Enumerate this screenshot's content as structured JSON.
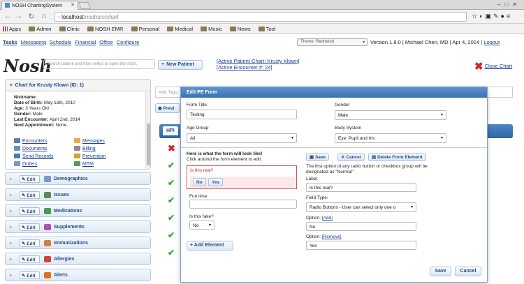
{
  "browser": {
    "tab_title": "NOSH ChartingSystem",
    "url_host": "localhost",
    "url_path": "/noshsrc/chart",
    "bookmarks": [
      "Apps",
      "Admin",
      "Clinic",
      "NOSH EMR",
      "Personal",
      "Medical",
      "Music",
      "News",
      "Tool"
    ]
  },
  "app": {
    "menu": [
      "Tasks",
      "Messaging",
      "Schedule",
      "Financial",
      "Office",
      "Configure"
    ],
    "theme_label": "Theme: Redmond",
    "version": "Version 1.8.0",
    "user": "Michael Chen, MD",
    "date": "Apr 4, 2014",
    "logout": "Logout",
    "logo": "Nosh",
    "search_placeholder": "Search patient and then select to open the chart.",
    "new_patient": "New Patient",
    "active_patient": "[Active Patient Chart: Krusty Klown]",
    "active_encounter": "[Active Encounter #: 24]",
    "close_chart": "Close Chart"
  },
  "patient": {
    "panel_title": "Chart for Krusty Klown (ID: 1)",
    "nickname_label": "Nickname:",
    "dob_label": "Date of Birth:",
    "dob": "May 13th, 2010",
    "age_label": "Age:",
    "age": "3 Years Old",
    "gender_label": "Gender:",
    "gender": "Male",
    "last_label": "Last Encounter:",
    "last": "April 2nd, 2014",
    "next_label": "Next Appointment:",
    "next": "None.",
    "links": [
      "Encounters",
      "Messages",
      "Documents",
      "Billing",
      "Send Records",
      "Prevention",
      "Orders",
      "MTM"
    ]
  },
  "sections": [
    {
      "edit": "Edit",
      "label": "Demographics"
    },
    {
      "edit": "Edit",
      "label": "Issues"
    },
    {
      "edit": "Edit",
      "label": "Medications"
    },
    {
      "edit": "Edit",
      "label": "Supplements"
    },
    {
      "edit": "Edit",
      "label": "Immunizations"
    },
    {
      "edit": "Edit",
      "label": "Allergies"
    },
    {
      "edit": "Edit",
      "label": "Alerts"
    }
  ],
  "main": {
    "tags_placeholder": "Add Tags",
    "prev_label": "Previ",
    "hpi_tab": "HPI"
  },
  "modal": {
    "title": "Edit PE Form",
    "form_title_label": "Form Title:",
    "form_title_value": "Testing",
    "gender_label": "Gender",
    "gender_value": "Male",
    "age_group_label": "Age Group",
    "age_group_value": "All",
    "body_system_label": "Body System",
    "body_system_value": "Eye: Pupil and Iris",
    "preview_heading_1": "Here is what the form will look like!",
    "preview_heading_2": "Click around the form element to edit.",
    "q1": "Is this real?",
    "q1_no": "No",
    "q1_yes": "Yes",
    "q2": "Fun time",
    "q3": "Is this fake?",
    "q3_value": "No",
    "add_element": "Add Element",
    "save_small": "Save",
    "cancel_small": "Cancel",
    "delete_element": "Delete Form Element",
    "note": "The first option of any radio button or checkbox group will be designated as \"Normal\"",
    "label_label": "Label:",
    "label_value": "Is this real?",
    "field_type_label": "Field Type:",
    "field_type_value": "Radio Buttons - User can select only one o",
    "option1_label": "Option:",
    "option1_link": "[Add]",
    "option1_value": "No",
    "option2_label": "Option:",
    "option2_link": "[Remove]",
    "option2_value": "Yes",
    "save": "Save",
    "cancel": "Cancel"
  },
  "colors": {
    "accent": "#2d66a8",
    "check": "#3da52f",
    "alert": "#d22222"
  }
}
